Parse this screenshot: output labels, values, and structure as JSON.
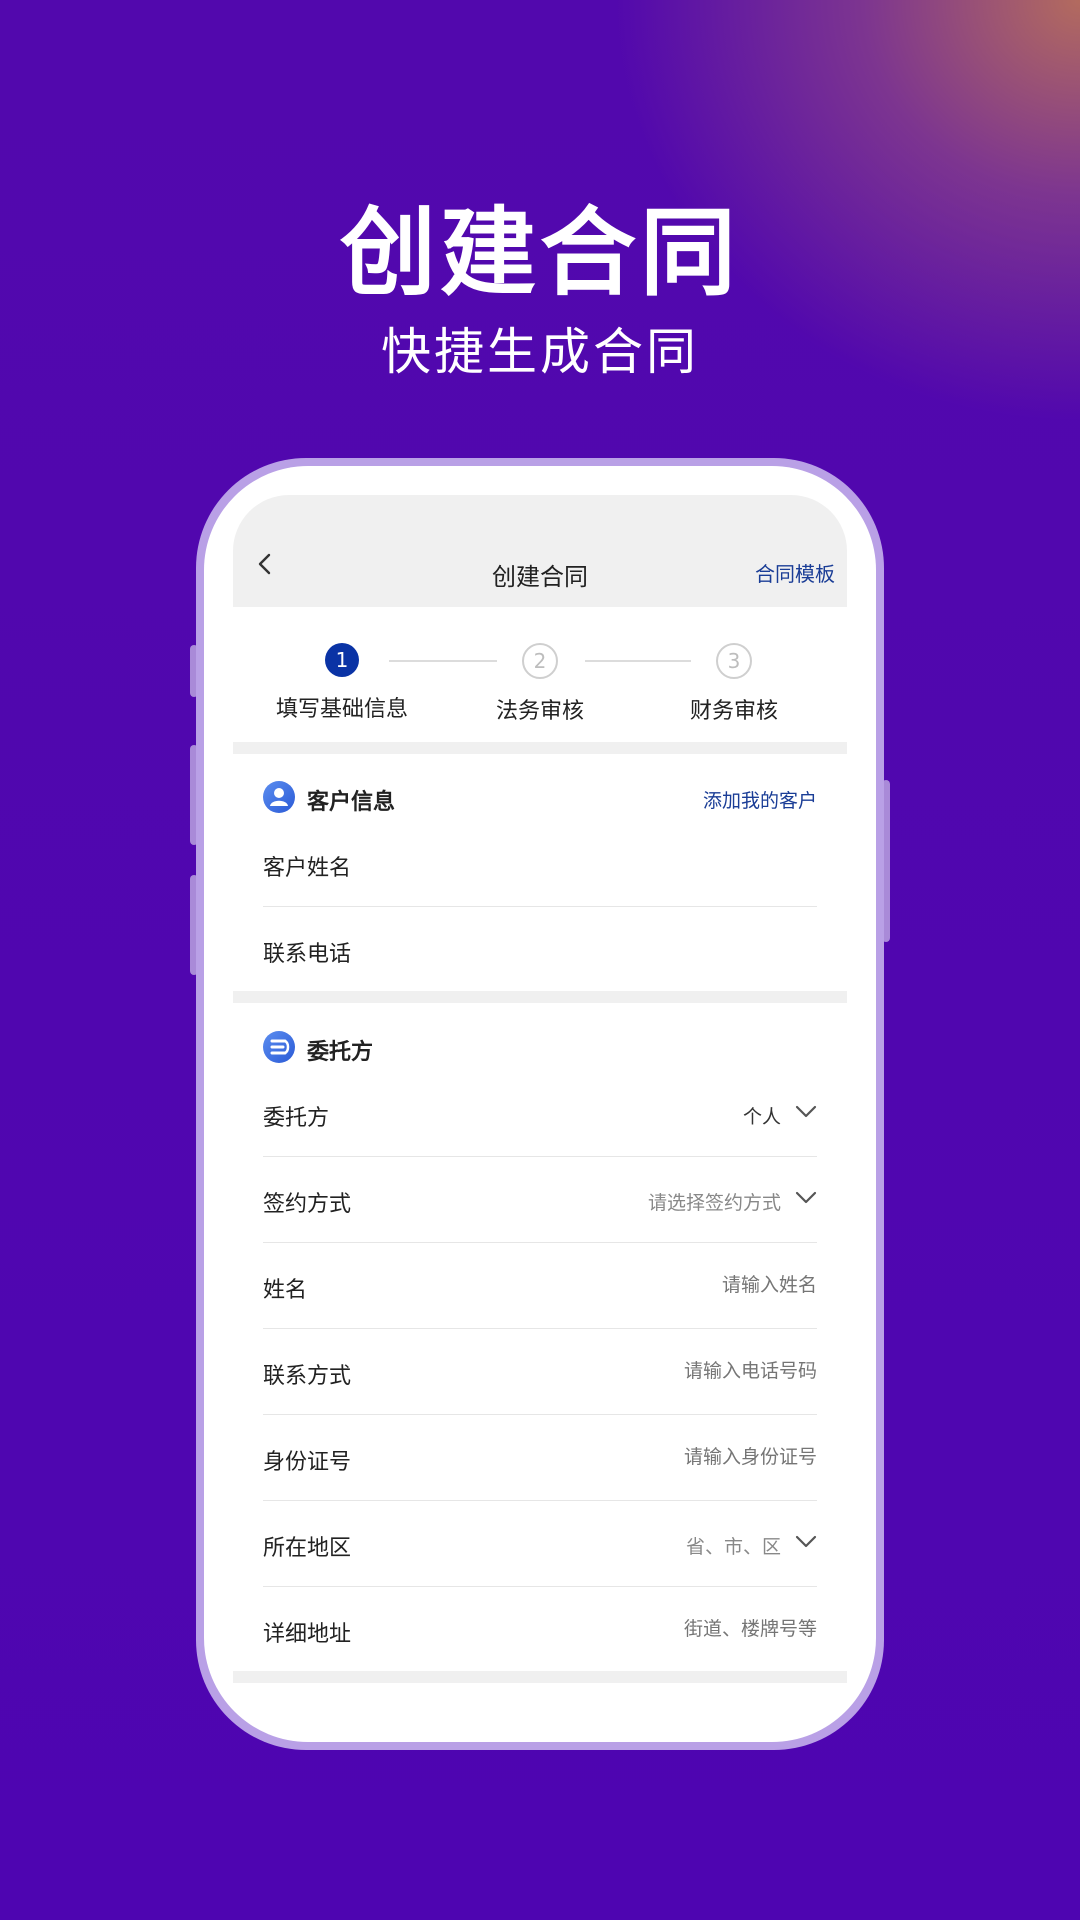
{
  "hero": {
    "title": "创建合同",
    "subtitle": "快捷生成合同"
  },
  "navbar": {
    "title": "创建合同",
    "action": "合同模板",
    "back_icon": "chevron-left-icon"
  },
  "steps": [
    {
      "number": "1",
      "label": "填写基础信息",
      "active": true
    },
    {
      "number": "2",
      "label": "法务审核",
      "active": false
    },
    {
      "number": "3",
      "label": "财务审核",
      "active": false
    }
  ],
  "customer_section": {
    "title": "客户信息",
    "link": "添加我的客户",
    "icon": "user-icon",
    "fields": [
      {
        "label": "客户姓名",
        "placeholder": ""
      },
      {
        "label": "联系电话",
        "placeholder": ""
      }
    ]
  },
  "principal_section": {
    "title": "委托方",
    "icon": "principal-icon",
    "fields": [
      {
        "label": "委托方",
        "value": "个人",
        "type": "select"
      },
      {
        "label": "签约方式",
        "placeholder": "请选择签约方式",
        "type": "select"
      },
      {
        "label": "姓名",
        "placeholder": "请输入姓名",
        "type": "input"
      },
      {
        "label": "联系方式",
        "placeholder": "请输入电话号码",
        "type": "input"
      },
      {
        "label": "身份证号",
        "placeholder": "请输入身份证号",
        "type": "input"
      },
      {
        "label": "所在地区",
        "placeholder": "省、市、区",
        "type": "select"
      },
      {
        "label": "详细地址",
        "placeholder": "街道、楼牌号等",
        "type": "input"
      }
    ]
  },
  "colors": {
    "background": "#4e05b1",
    "accent": "#0a33a5",
    "link": "#1a3d96",
    "phone_frame": "#b9a0e6"
  }
}
